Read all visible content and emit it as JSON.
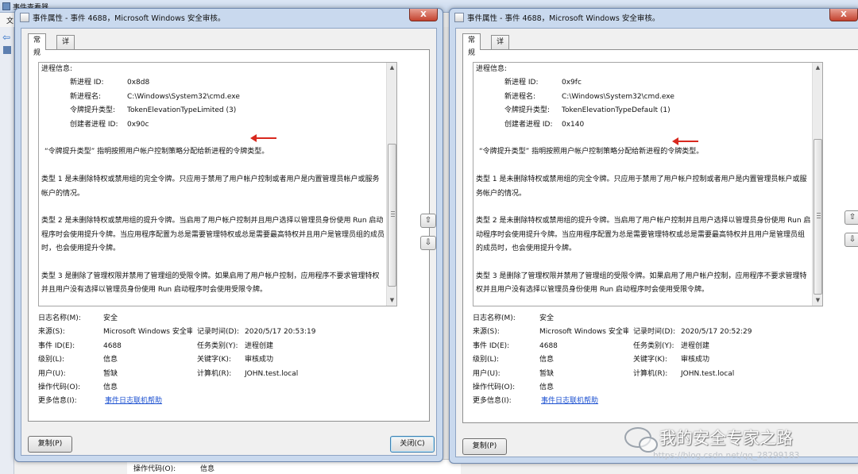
{
  "background": {
    "title": "事件查看器",
    "menu_char": "文",
    "bottom_label": "操作代码(O):",
    "bottom_value": "信息"
  },
  "common": {
    "tab_general": "常规",
    "tab_details": "详细信息",
    "copy_button": "复制(P)",
    "close_button": "关闭(C)",
    "close_x": "X",
    "field_labels": {
      "log_name": "日志名称(M):",
      "source": "来源(S):",
      "event_id": "事件 ID(E):",
      "level": "级别(L):",
      "user": "用户(U):",
      "opcode": "操作代码(O):",
      "more_info": "更多信息(I):",
      "logged": "记录时间(D):",
      "task_category": "任务类别(Y):",
      "keywords": "关键字(K):",
      "computer": "计算机(R):"
    },
    "description": {
      "process_info": "进程信息:",
      "new_pid_label": "新进程 ID:",
      "new_name_label": "新进程名:",
      "token_label": "令牌提升类型:",
      "creator_label": "创建者进程 ID:",
      "token_explain": "“令牌提升类型” 指明按照用户帐户控制策略分配给新进程的令牌类型。",
      "type1": "类型 1 是未删除特权或禁用组的完全令牌。只应用于禁用了用户帐户控制或者用户是内置管理员帐户或服务帐户的情况。",
      "type2": "类型 2 是未删除特权或禁用组的提升令牌。当启用了用户帐户控制并且用户选择以管理员身份使用 Run 启动程序时会使用提升令牌。当应用程序配置为总是需要管理特权或总是需要最高特权并且用户是管理员组的成员时，也会使用提升令牌。",
      "type3": "类型 3 是删除了管理权限并禁用了管理组的受限令牌。如果启用了用户帐户控制，应用程序不要求管理特权并且用户没有选择以管理员身份使用 Run 启动程序时会使用受限令牌。"
    }
  },
  "dialog_left": {
    "title": "事件属性 - 事件 4688，Microsoft Windows 安全审核。",
    "new_pid": "0x8d8",
    "new_name": "C:\\Windows\\System32\\cmd.exe",
    "token_type": "TokenElevationTypeLimited (3)",
    "creator_pid": "0x90c",
    "log_name": "安全",
    "source": "Microsoft Windows 安全审",
    "logged": "2020/5/17 20:53:19",
    "event_id": "4688",
    "task_category": "进程创建",
    "level": "信息",
    "keywords": "审核成功",
    "user": "暂缺",
    "computer": "JOHN.test.local",
    "opcode": "信息",
    "more_info_link": "事件日志联机帮助"
  },
  "dialog_right": {
    "title": "事件属性 - 事件 4688，Microsoft Windows 安全审核。",
    "new_pid": "0x9fc",
    "new_name": "C:\\Windows\\System32\\cmd.exe",
    "token_type": "TokenElevationTypeDefault (1)",
    "creator_pid": "0x140",
    "log_name": "安全",
    "source": "Microsoft Windows 安全审",
    "logged": "2020/5/17 20:52:29",
    "event_id": "4688",
    "task_category": "进程创建",
    "level": "信息",
    "keywords": "审核成功",
    "user": "暂缺",
    "computer": "JOHN.test.local",
    "opcode": "信息",
    "more_info_link": "事件日志联机帮助"
  },
  "watermark": {
    "text": "我的安全专家之路",
    "url": "https://blog.csdn.net/qq_28299183"
  },
  "colors": {
    "arrow": "#d8281e",
    "link": "#1a4fd0",
    "frame": "#c9d9ee"
  }
}
